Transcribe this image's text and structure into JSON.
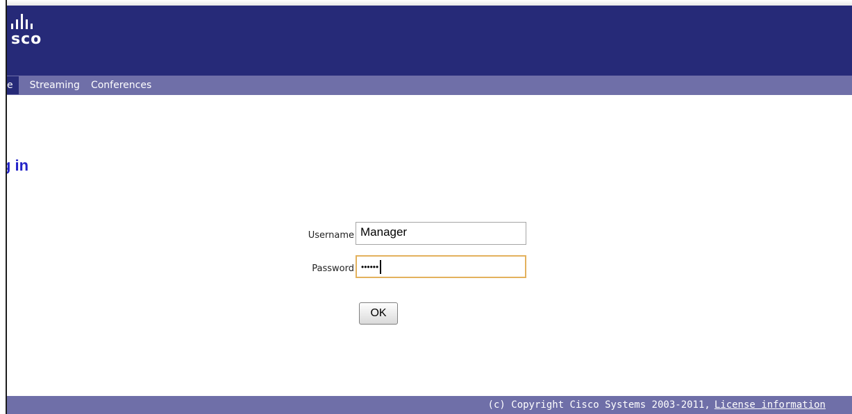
{
  "header": {
    "logo_text": "sco"
  },
  "nav": {
    "items": [
      {
        "label": "e",
        "active": true
      },
      {
        "label": "Streaming",
        "active": false
      },
      {
        "label": "Conferences",
        "active": false
      }
    ]
  },
  "page": {
    "title": "g in"
  },
  "form": {
    "username_label": "Username",
    "username_value": "Manager",
    "password_label": "Password",
    "password_masked": "••••••",
    "ok_label": "OK"
  },
  "footer": {
    "copyright": "(c) Copyright Cisco Systems 2003-2011,",
    "license_link": "License information"
  },
  "colors": {
    "header_bg": "#262a78",
    "nav_bg": "#6f6fa8",
    "title_blue": "#2323c8",
    "focus_border": "#e3b15c"
  },
  "icons": {
    "logo": "cisco-logo-icon"
  }
}
